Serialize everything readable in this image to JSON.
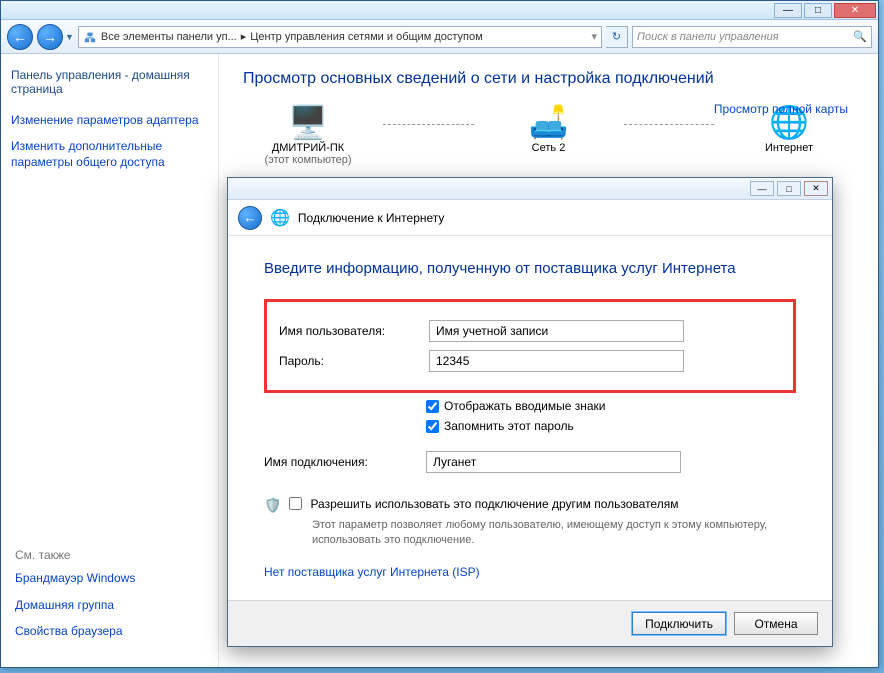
{
  "explorer": {
    "breadcrumb": [
      "Все элементы панели уп...",
      "Центр управления сетями и общим доступом"
    ],
    "search_placeholder": "Поиск в панели управления"
  },
  "sidebar": {
    "home": "Панель управления - домашняя страница",
    "links": [
      "Изменение параметров адаптера",
      "Изменить дополнительные параметры общего доступа"
    ],
    "see_also_hdr": "См. также",
    "see_also": [
      "Брандмауэр Windows",
      "Домашняя группа",
      "Свойства браузера"
    ]
  },
  "main": {
    "heading": "Просмотр основных сведений о сети и настройка подключений",
    "map_link": "Просмотр полной карты",
    "nodes": {
      "pc": "ДМИТРИЙ-ПК",
      "pc_sub": "(этот компьютер)",
      "net": "Сеть 2",
      "inet": "Интернет"
    }
  },
  "dialog": {
    "title": "Подключение к Интернету",
    "heading": "Введите информацию, полученную от поставщика услуг Интернета",
    "username_label": "Имя пользователя:",
    "username_value": "Имя учетной записи",
    "password_label": "Пароль:",
    "password_value": "12345",
    "show_chars": "Отображать вводимые знаки",
    "remember": "Запомнить этот пароль",
    "conn_name_label": "Имя подключения:",
    "conn_name_value": "Луганет",
    "allow_others": "Разрешить использовать это подключение другим пользователям",
    "allow_others_desc": "Этот параметр позволяет любому пользователю, имеющему доступ к этому компьютеру, использовать это подключение.",
    "isp_link": "Нет поставщика услуг Интернета (ISP)",
    "connect_btn": "Подключить",
    "cancel_btn": "Отмена"
  }
}
